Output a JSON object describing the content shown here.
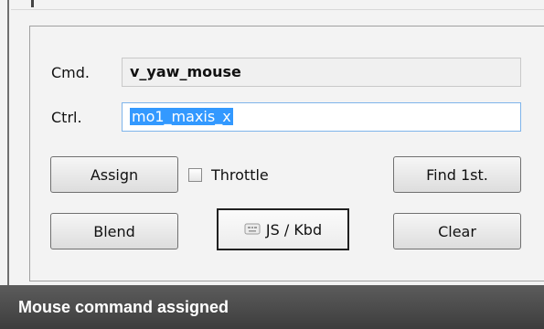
{
  "form": {
    "cmd_label": "Cmd.",
    "cmd_value": "v_yaw_mouse",
    "ctrl_label": "Ctrl.",
    "ctrl_value": "mo1_maxis_x"
  },
  "buttons": {
    "assign": "Assign",
    "find_first": "Find 1st.",
    "blend": "Blend",
    "js_kbd": "JS / Kbd",
    "clear": "Clear"
  },
  "checkbox": {
    "label": "Throttle",
    "checked": false
  },
  "status": {
    "text": "Mouse command assigned"
  },
  "icons": {
    "js_kbd_icon": "controller-icon",
    "throttle_checkbox": "checkbox-icon"
  },
  "colors": {
    "selection": "#3399ff",
    "status_background": "#4a4a4a",
    "focus_border": "#7eb4ea"
  }
}
